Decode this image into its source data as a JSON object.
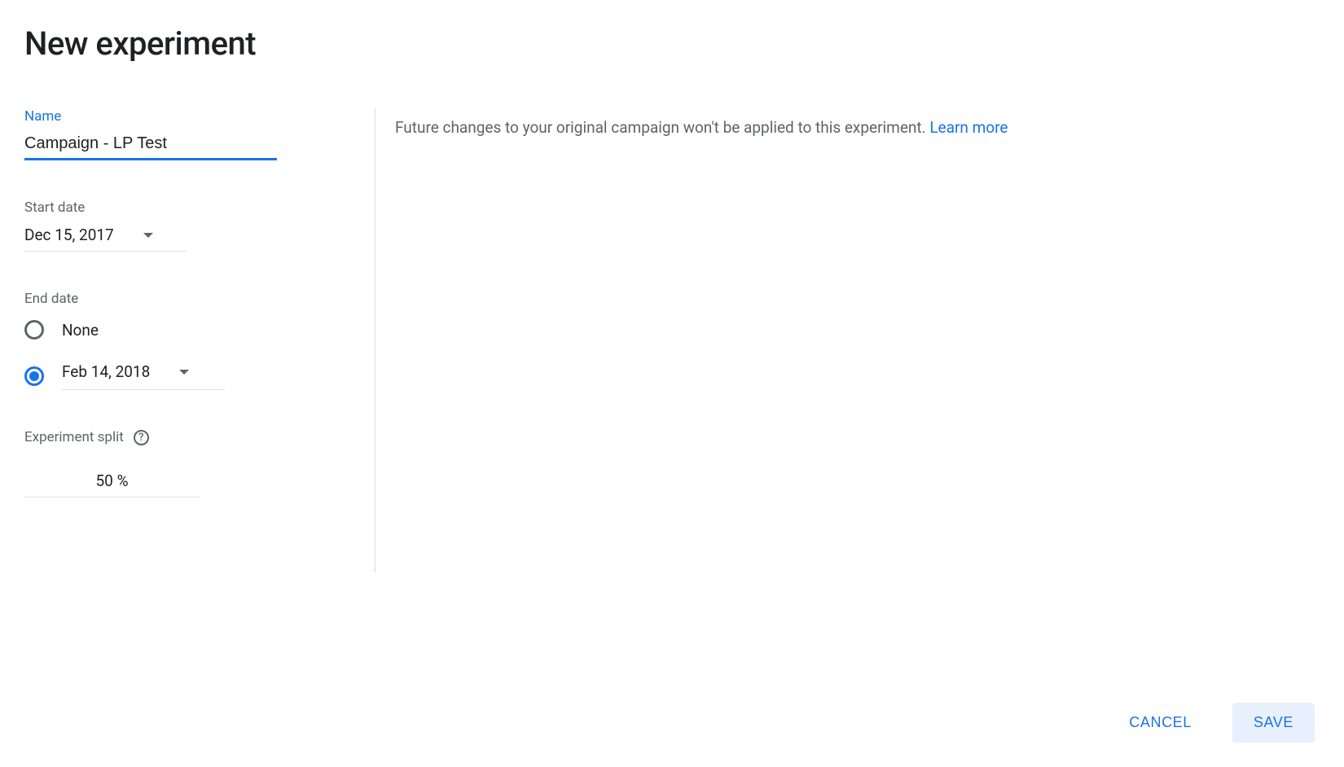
{
  "header": {
    "title": "New experiment"
  },
  "form": {
    "name": {
      "label": "Name",
      "value": "Campaign - LP Test"
    },
    "start_date": {
      "label": "Start date",
      "value": "Dec 15, 2017"
    },
    "end_date": {
      "label": "End date",
      "none_option": "None",
      "date_value": "Feb 14, 2018",
      "selected": "date"
    },
    "experiment_split": {
      "label": "Experiment split",
      "value": "50 %"
    }
  },
  "info": {
    "text": "Future changes to your original campaign won't be applied to this experiment. ",
    "learn_more": "Learn more"
  },
  "actions": {
    "cancel": "CANCEL",
    "save": "SAVE"
  }
}
